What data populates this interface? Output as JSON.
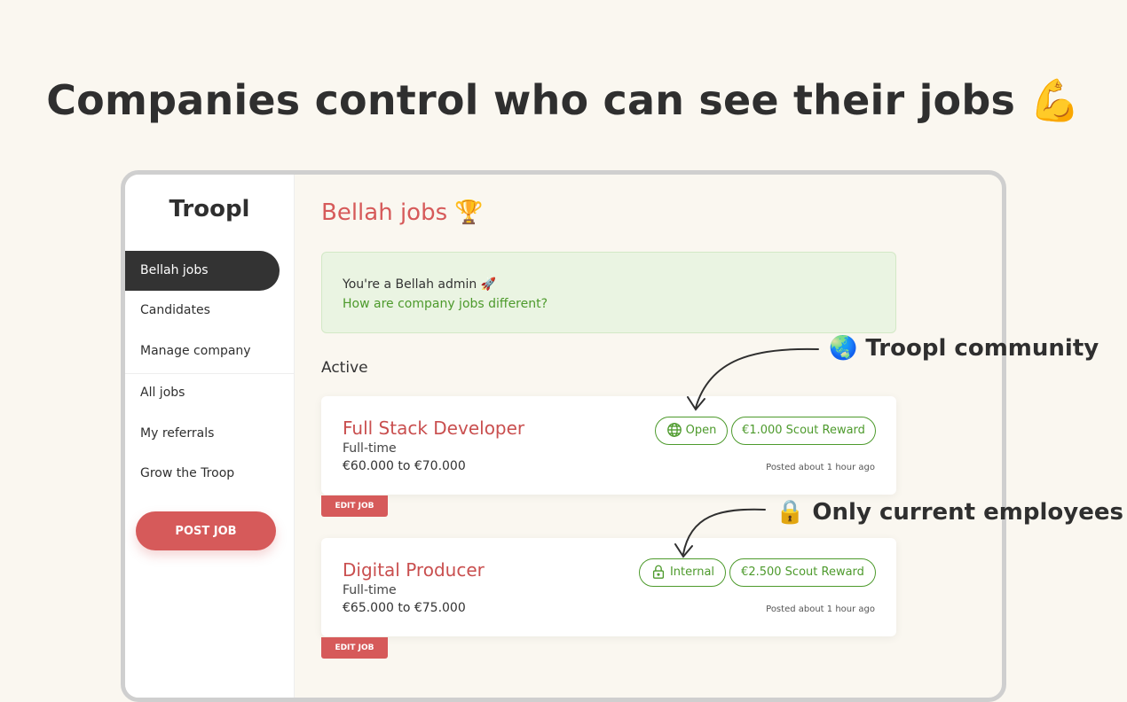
{
  "headline": "Companies control who can see their jobs 💪",
  "sidebar": {
    "brand": "Troopl",
    "items": [
      {
        "label": "Bellah jobs",
        "active": true
      },
      {
        "label": "Candidates"
      },
      {
        "label": "Manage company"
      },
      {
        "label": "All jobs"
      },
      {
        "label": "My referrals"
      },
      {
        "label": "Grow the Troop"
      }
    ],
    "post_job_label": "POST JOB"
  },
  "main": {
    "title": "Bellah jobs 🏆",
    "info": {
      "text": "You're a Bellah admin 🚀",
      "link": "How are company jobs different?"
    },
    "section_label": "Active",
    "jobs": [
      {
        "title": "Full Stack Developer",
        "type": "Full-time",
        "salary": "€60.000 to €70.000",
        "visibility_label": "Open",
        "visibility_icon": "globe-icon",
        "reward": "€1.000 Scout Reward",
        "posted": "Posted about 1 hour ago",
        "edit_label": "EDIT JOB"
      },
      {
        "title": "Digital Producer",
        "type": "Full-time",
        "salary": "€65.000 to €75.000",
        "visibility_label": "Internal",
        "visibility_icon": "lock-icon",
        "reward": "€2.500 Scout Reward",
        "posted": "Posted about 1 hour ago",
        "edit_label": "EDIT JOB"
      }
    ]
  },
  "callouts": {
    "community": "🌏 Troopl community",
    "employees": "🔒 Only current employees"
  },
  "colors": {
    "accent": "#d65a5a",
    "green": "#4d9a2c",
    "background": "#faf7f0"
  }
}
